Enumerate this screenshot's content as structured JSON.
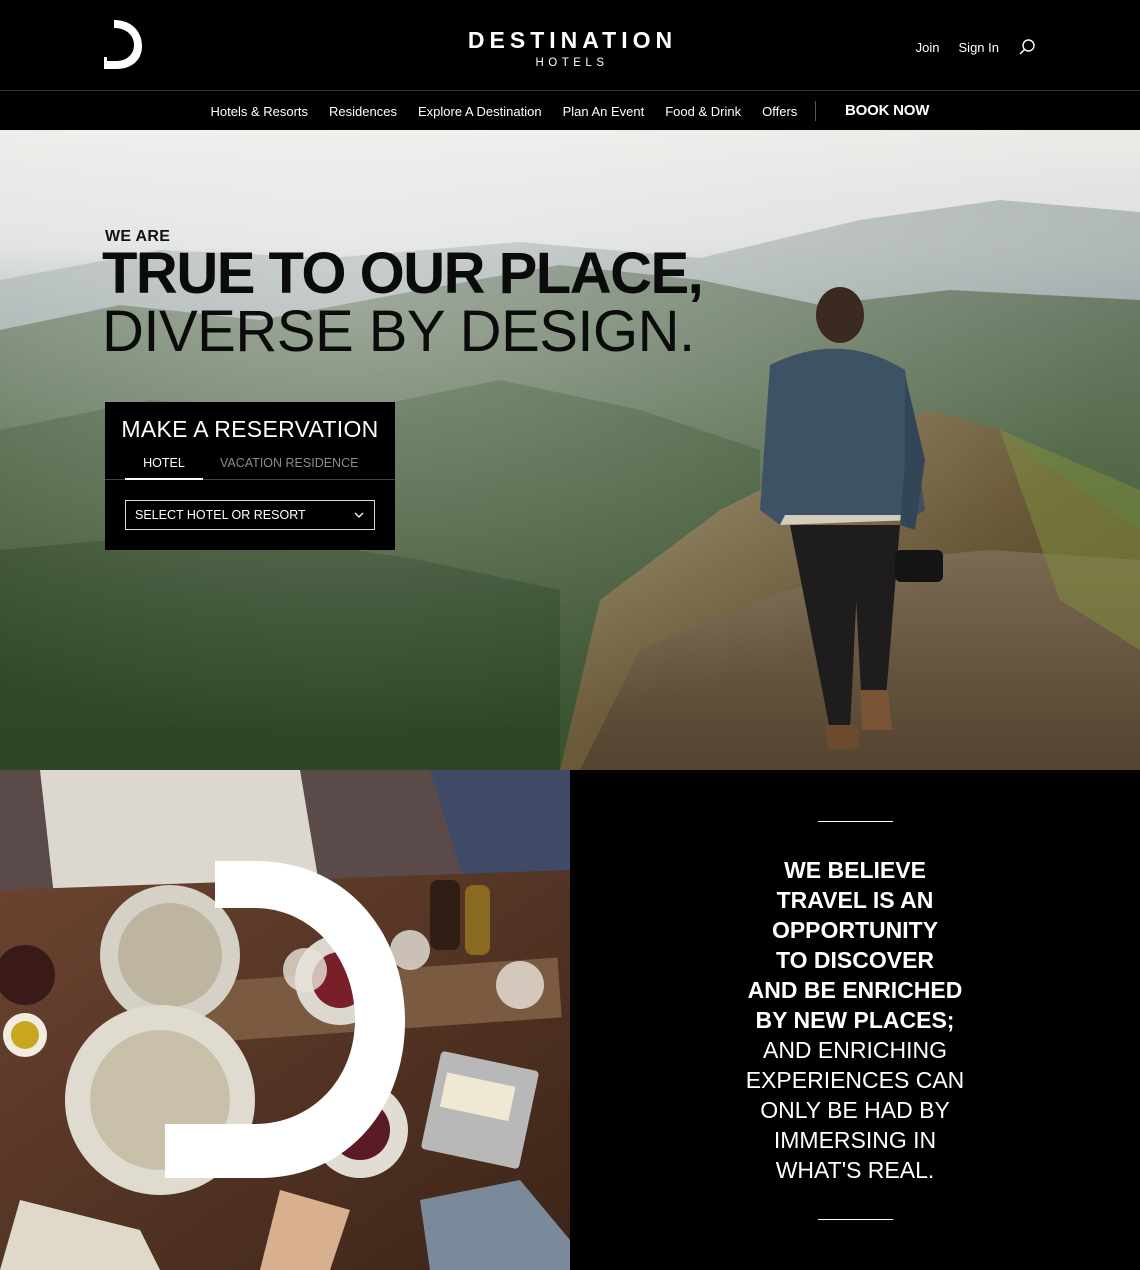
{
  "brand": {
    "name": "DESTINATION",
    "subtitle": "HOTELS",
    "logo_icon": "destination-d-logo-icon"
  },
  "header": {
    "join_label": "Join",
    "signin_label": "Sign In",
    "search_icon": "search-icon"
  },
  "nav": {
    "items": [
      {
        "label": "Hotels & Resorts"
      },
      {
        "label": "Residences"
      },
      {
        "label": "Explore A Destination"
      },
      {
        "label": "Plan An Event"
      },
      {
        "label": "Food & Drink"
      },
      {
        "label": "Offers"
      }
    ],
    "book_now": "BOOK NOW"
  },
  "hero": {
    "eyebrow": "WE ARE",
    "line1": "TRUE TO OUR PLACE,",
    "line2": "DIVERSE BY DESIGN."
  },
  "reservation": {
    "title": "MAKE A RESERVATION",
    "tabs": [
      {
        "label": "HOTEL",
        "active": true
      },
      {
        "label": "VACATION RESIDENCE",
        "active": false
      }
    ],
    "select_label": "SELECT HOTEL OR RESORT"
  },
  "belief": {
    "strong_lines": [
      "WE BELIEVE",
      "TRAVEL IS AN",
      "OPPORTUNITY",
      "TO DISCOVER",
      "AND BE ENRICHED",
      "BY NEW PLACES;"
    ],
    "light_lines": [
      "AND ENRICHING",
      "EXPERIENCES CAN",
      "ONLY BE HAD BY",
      "IMMERSING IN",
      "WHAT'S REAL."
    ]
  },
  "colors": {
    "background": "#000000",
    "text": "#ffffff",
    "hero_text": "#0b0b0b",
    "inactive_tab": "#8c8c8c"
  }
}
